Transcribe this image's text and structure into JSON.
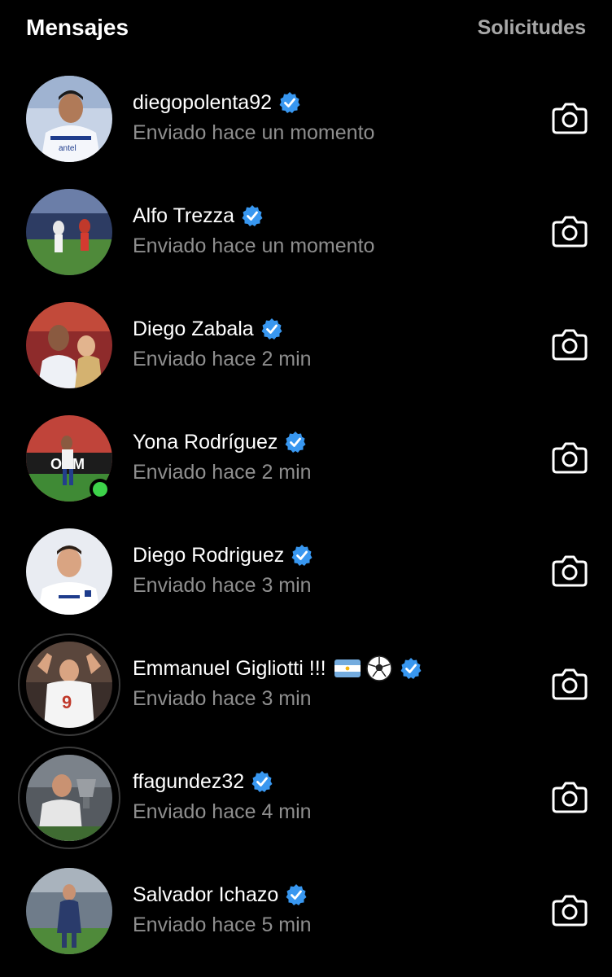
{
  "header": {
    "title": "Mensajes",
    "requests": "Solicitudes"
  },
  "colors": {
    "background": "#000000",
    "secondary_text": "#8e8e8e",
    "verified_blue": "#3897f0",
    "online_green": "#3dd34a"
  },
  "conversations": [
    {
      "name": "diegopolenta92",
      "status": "Enviado hace un momento",
      "verified": true,
      "online": false,
      "story_ring": false
    },
    {
      "name": "Alfo Trezza",
      "status": "Enviado hace un momento",
      "verified": true,
      "online": false,
      "story_ring": false
    },
    {
      "name": "Diego Zabala",
      "status": "Enviado hace 2 min",
      "verified": true,
      "online": false,
      "story_ring": false
    },
    {
      "name": "Yona Rodríguez",
      "status": "Enviado hace 2 min",
      "verified": true,
      "online": true,
      "story_ring": false
    },
    {
      "name": "Diego Rodriguez",
      "status": "Enviado hace 3 min",
      "verified": true,
      "online": false,
      "story_ring": false
    },
    {
      "name": "Emmanuel Gigliotti !!!",
      "status": "Enviado hace 3 min",
      "verified": true,
      "online": false,
      "story_ring": true,
      "emojis": [
        "flag-argentina-icon",
        "soccer-ball-icon"
      ]
    },
    {
      "name": "ffagundez32",
      "status": "Enviado hace 4 min",
      "verified": true,
      "online": false,
      "story_ring": true
    },
    {
      "name": "Salvador Ichazo",
      "status": "Enviado hace 5 min",
      "verified": true,
      "online": false,
      "story_ring": false
    }
  ]
}
